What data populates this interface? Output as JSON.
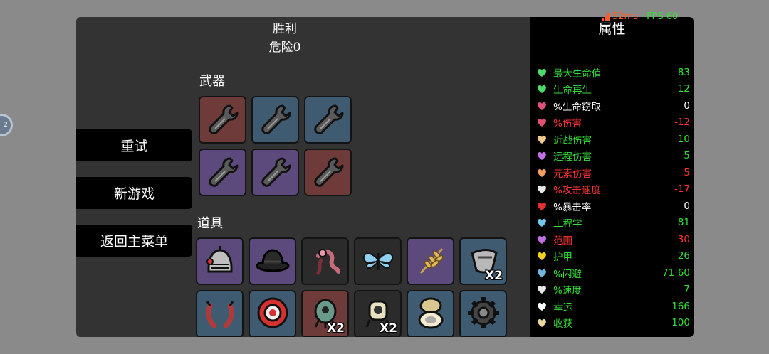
{
  "header": {
    "result_title": "胜利",
    "danger_label": "危险0"
  },
  "menu": {
    "retry": "重试",
    "new_game": "新游戏",
    "main_menu": "返回主菜单"
  },
  "weapons": {
    "label": "武器",
    "slots": [
      {
        "icon": "wrench-icon",
        "tier_color": "#6e3a3a"
      },
      {
        "icon": "wrench-icon",
        "tier_color": "#3f5b71"
      },
      {
        "icon": "wrench-icon",
        "tier_color": "#3f5b71"
      },
      {
        "icon": "wrench-icon",
        "tier_color": "#5c4a7c"
      },
      {
        "icon": "wrench-icon",
        "tier_color": "#5c4a7c"
      },
      {
        "icon": "wrench-icon",
        "tier_color": "#6e3a3a"
      }
    ]
  },
  "items": {
    "label": "道具",
    "slots": [
      {
        "icon": "knight-helmet-icon",
        "tier_color": "#5c4a7c",
        "qty": ""
      },
      {
        "icon": "bowler-hat-icon",
        "tier_color": "#5c4a7c",
        "qty": ""
      },
      {
        "icon": "tentacle-creature-icon",
        "tier_color": "#2b2b2b",
        "qty": ""
      },
      {
        "icon": "butterfly-icon",
        "tier_color": "#2b2b2b",
        "qty": ""
      },
      {
        "icon": "wheat-icon",
        "tier_color": "#5c4a7c",
        "qty": ""
      },
      {
        "icon": "visor-icon",
        "tier_color": "#3f5b71",
        "qty": "X2"
      },
      {
        "icon": "claws-icon",
        "tier_color": "#3f5b71",
        "qty": ""
      },
      {
        "icon": "red-disc-icon",
        "tier_color": "#3f5b71",
        "qty": ""
      },
      {
        "icon": "alien-pod-icon",
        "tier_color": "#6e3a3a",
        "qty": "X2"
      },
      {
        "icon": "robot-pod-icon",
        "tier_color": "#2b2b2b",
        "qty": "X2"
      },
      {
        "icon": "compact-mirror-icon",
        "tier_color": "#3f5b71",
        "qty": ""
      },
      {
        "icon": "cog-icon",
        "tier_color": "#3f5b71",
        "qty": ""
      }
    ]
  },
  "stats": {
    "title": "属性",
    "rows": [
      {
        "label": "最大生命值",
        "value": "83",
        "color": "#35e03a",
        "icon": "heart-icon",
        "icon_color": "#4cdb6a"
      },
      {
        "label": "生命再生",
        "value": "12",
        "color": "#35e03a",
        "icon": "regen-icon",
        "icon_color": "#4cdb6a"
      },
      {
        "label": "%生命窃取",
        "value": "0",
        "color": "#ffffff",
        "icon": "fangs-icon",
        "icon_color": "#e0507a"
      },
      {
        "label": "%伤害",
        "value": "-12",
        "color": "#ff3333",
        "icon": "muscle-icon",
        "icon_color": "#e05070"
      },
      {
        "label": "近战伤害",
        "value": "10",
        "color": "#35e03a",
        "icon": "sword-icon",
        "icon_color": "#f0c890"
      },
      {
        "label": "远程伤害",
        "value": "5",
        "color": "#35e03a",
        "icon": "bow-icon",
        "icon_color": "#c070e0"
      },
      {
        "label": "元素伤害",
        "value": "-5",
        "color": "#ff3333",
        "icon": "flame-icon",
        "icon_color": "#f0a060"
      },
      {
        "label": "%攻击速度",
        "value": "-17",
        "color": "#ff3333",
        "icon": "hourglass-icon",
        "icon_color": "#e8e8e8"
      },
      {
        "label": "%暴击率",
        "value": "0",
        "color": "#ffffff",
        "icon": "crit-icon",
        "icon_color": "#e03030"
      },
      {
        "label": "工程学",
        "value": "81",
        "color": "#35e03a",
        "icon": "wrench-cross-icon",
        "icon_color": "#70c8f0"
      },
      {
        "label": "范围",
        "value": "-30",
        "color": "#ff3333",
        "icon": "range-icon",
        "icon_color": "#c070e0"
      },
      {
        "label": "护甲",
        "value": "26",
        "color": "#35e03a",
        "icon": "shield-icon",
        "icon_color": "#f0d020"
      },
      {
        "label": "%闪避",
        "value": "71|60",
        "color": "#35e03a",
        "icon": "dodge-icon",
        "icon_color": "#70b8e0"
      },
      {
        "label": "%速度",
        "value": "7",
        "color": "#35e03a",
        "icon": "boot-icon",
        "icon_color": "#e8e8e8"
      },
      {
        "label": "幸运",
        "value": "166",
        "color": "#35e03a",
        "icon": "dice-icon",
        "icon_color": "#ffffff"
      },
      {
        "label": "收获",
        "value": "100",
        "color": "#35e03a",
        "icon": "harvest-icon",
        "icon_color": "#e8d8a0"
      }
    ]
  },
  "perf": {
    "latency": "52ms",
    "separator": "·",
    "fps": "FPS 60"
  }
}
